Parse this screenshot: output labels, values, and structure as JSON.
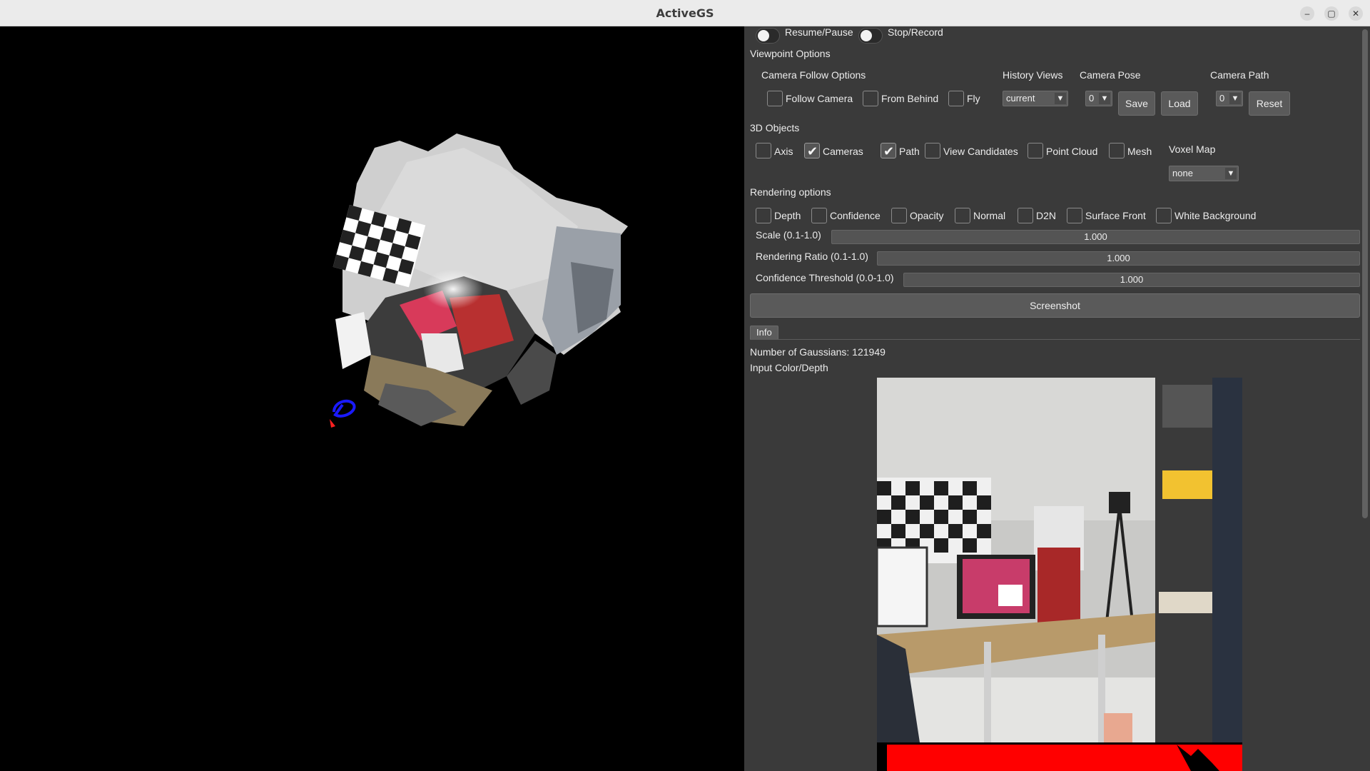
{
  "window": {
    "title": "ActiveGS",
    "minimize_glyph": "–",
    "maximize_glyph": "▢",
    "close_glyph": "✕"
  },
  "controls": {
    "resume_pause": {
      "label": "Resume/Pause",
      "on": false
    },
    "stop_record": {
      "label": "Stop/Record",
      "on": false
    }
  },
  "viewpoint": {
    "title": "Viewpoint Options",
    "follow_title": "Camera Follow Options",
    "follow_camera": {
      "label": "Follow Camera",
      "checked": false
    },
    "from_behind": {
      "label": "From Behind",
      "checked": false
    },
    "fly": {
      "label": "Fly",
      "checked": false
    },
    "history_views_title": "History Views",
    "history_views_value": "current",
    "camera_pose_title": "Camera Pose",
    "camera_pose_value": "0",
    "save_label": "Save",
    "load_label": "Load",
    "camera_path_title": "Camera Path",
    "camera_path_value": "0",
    "reset_label": "Reset"
  },
  "objects": {
    "title": "3D Objects",
    "axis": {
      "label": "Axis",
      "checked": false
    },
    "cameras": {
      "label": "Cameras",
      "checked": true
    },
    "path": {
      "label": "Path",
      "checked": true
    },
    "view_candidates": {
      "label": "View Candidates",
      "checked": false
    },
    "point_cloud": {
      "label": "Point Cloud",
      "checked": false
    },
    "mesh": {
      "label": "Mesh",
      "checked": false
    },
    "voxel_map_title": "Voxel Map",
    "voxel_map_value": "none"
  },
  "rendering": {
    "title": "Rendering options",
    "depth": {
      "label": "Depth",
      "checked": false
    },
    "confidence": {
      "label": "Confidence",
      "checked": false
    },
    "opacity": {
      "label": "Opacity",
      "checked": false
    },
    "normal": {
      "label": "Normal",
      "checked": false
    },
    "d2n": {
      "label": "D2N",
      "checked": false
    },
    "surface_front": {
      "label": "Surface Front",
      "checked": false
    },
    "white_background": {
      "label": "White Background",
      "checked": false
    },
    "scale": {
      "label": "Scale (0.1-1.0)",
      "value": "1.000"
    },
    "rendering_ratio": {
      "label": "Rendering Ratio (0.1-1.0)",
      "value": "1.000"
    },
    "confidence_threshold": {
      "label": "Confidence Threshold (0.0-1.0)",
      "value": "1.000"
    },
    "screenshot_label": "Screenshot"
  },
  "info": {
    "tab_label": "Info",
    "gaussians": "Number of Gaussians: 121949",
    "input_label": "Input Color/Depth"
  },
  "icons": {
    "check": "✔",
    "dropdown": "▼"
  },
  "colors": {
    "panel_bg": "#3a3a3a",
    "viewport_bg": "#000000",
    "depth_red": "#ff0000",
    "path_blue": "#1a1aff"
  }
}
